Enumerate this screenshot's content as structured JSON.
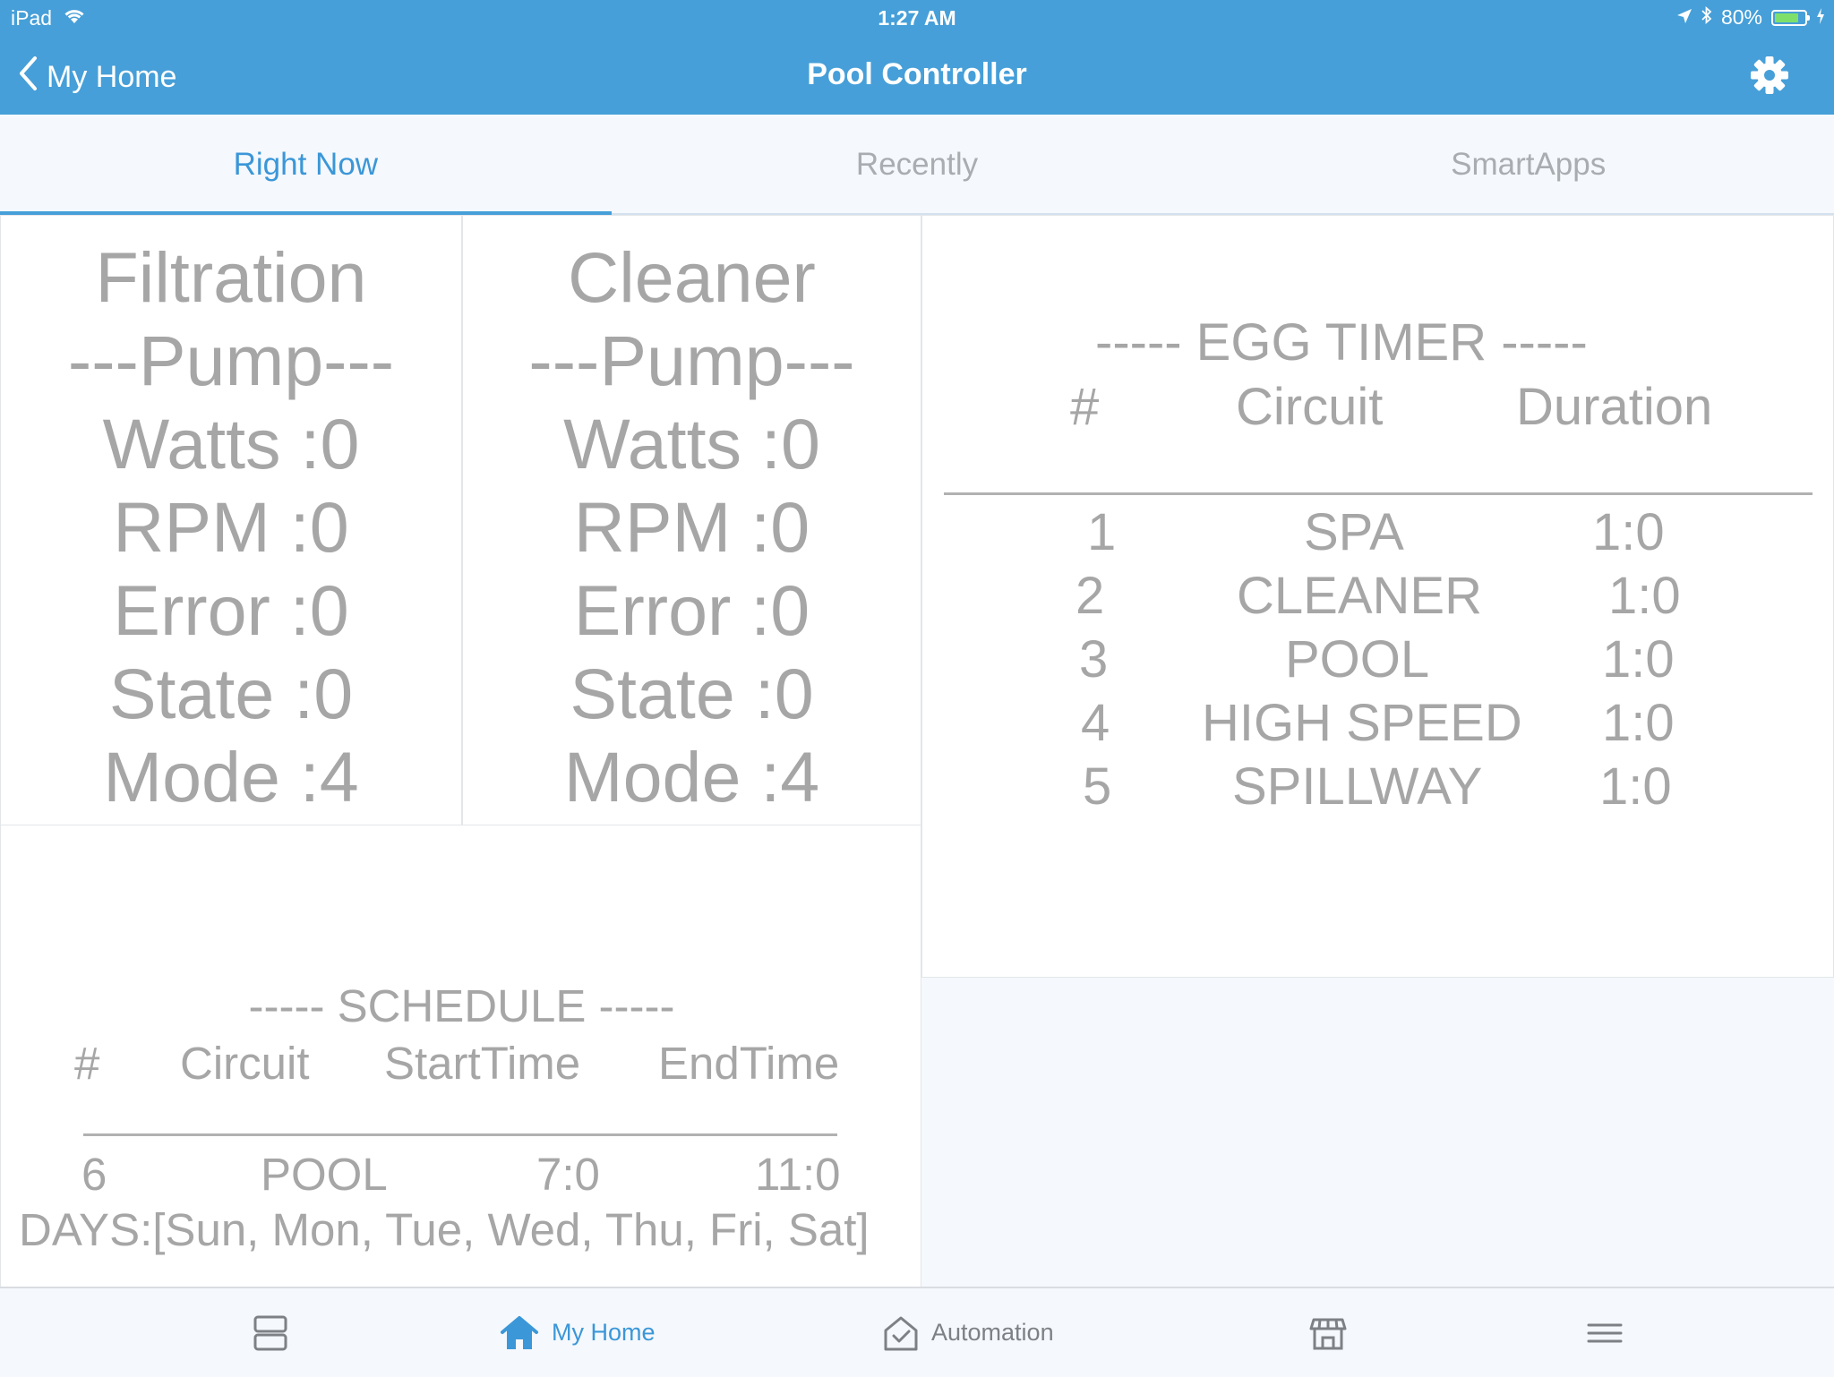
{
  "status_bar": {
    "device": "iPad",
    "time": "1:27 AM",
    "battery": "80%",
    "battery_level": 0.8,
    "icons": [
      "wifi-icon",
      "location-icon",
      "bluetooth-icon",
      "battery-icon",
      "charging-icon"
    ]
  },
  "nav": {
    "back_label": "My Home",
    "title": "Pool Controller",
    "settings_icon": "gear-icon"
  },
  "tabs": [
    {
      "label": "Right Now",
      "active": true
    },
    {
      "label": "Recently",
      "active": false
    },
    {
      "label": "SmartApps",
      "active": false
    }
  ],
  "filtration_pump": {
    "line1": "Filtration",
    "line2": "---Pump---",
    "watts": "Watts :0",
    "rpm": "RPM :0",
    "error": "Error :0",
    "state": "State :0",
    "mode": "Mode :4"
  },
  "cleaner_pump": {
    "line1": "Cleaner",
    "line2": "---Pump---",
    "watts": "Watts :0",
    "rpm": "RPM :0",
    "error": "Error :0",
    "state": "State :0",
    "mode": "Mode :4"
  },
  "egg_timer": {
    "title": "----- EGG TIMER -----",
    "headers": [
      "#",
      "Circuit",
      "Duration"
    ],
    "rows": [
      [
        "1",
        "SPA",
        "1:0"
      ],
      [
        "2",
        "CLEANER",
        "1:0"
      ],
      [
        "3",
        "POOL",
        "1:0"
      ],
      [
        "4",
        "HIGH SPEED",
        "1:0"
      ],
      [
        "5",
        "SPILLWAY",
        "1:0"
      ]
    ]
  },
  "schedule": {
    "title": "----- SCHEDULE -----",
    "headers": [
      "#",
      "Circuit",
      "StartTime",
      "EndTime"
    ],
    "row": [
      "6",
      "POOL",
      "7:0",
      "11:0"
    ],
    "days": "DAYS:[Sun, Mon, Tue, Wed, Thu, Fri, Sat]"
  },
  "bottom_nav": [
    {
      "label": "",
      "icon": "dashboard-icon",
      "active": false
    },
    {
      "label": "My Home",
      "icon": "home-icon",
      "active": true
    },
    {
      "label": "Automation",
      "icon": "automation-icon",
      "active": false
    },
    {
      "label": "",
      "icon": "marketplace-icon",
      "active": false
    },
    {
      "label": "",
      "icon": "menu-icon",
      "active": false
    }
  ],
  "colors": {
    "brand_blue": "#469fd8",
    "active_text": "#3b97d8",
    "tile_text": "#a6a6a6",
    "background": "#f5f8fc"
  }
}
